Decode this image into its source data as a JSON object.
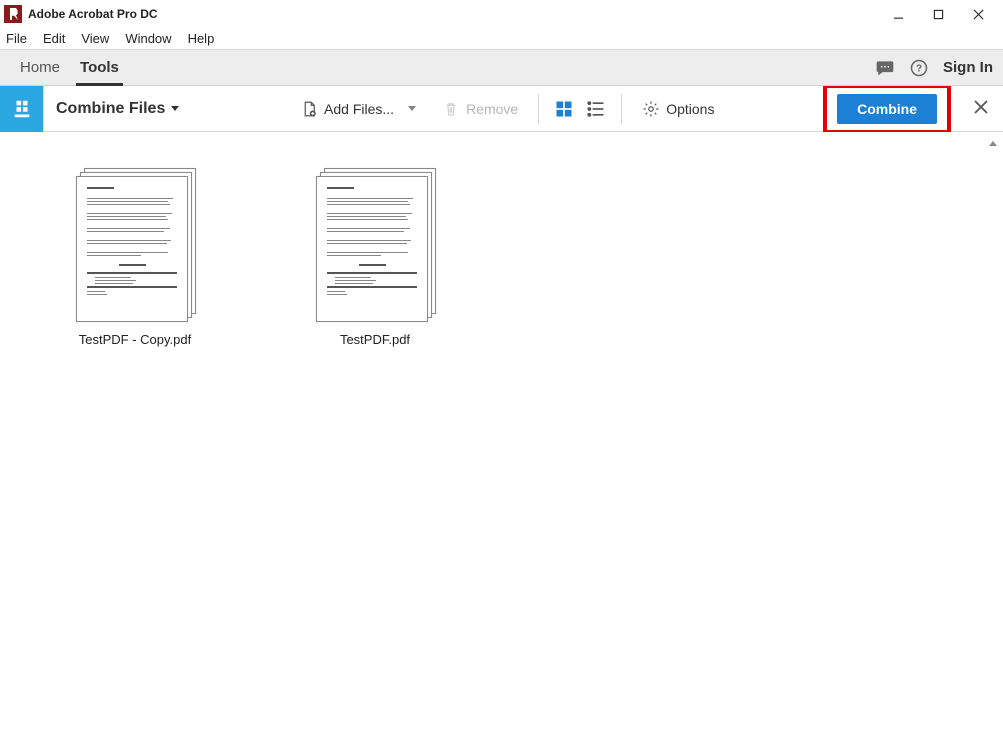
{
  "window": {
    "title": "Adobe Acrobat Pro DC"
  },
  "menubar": [
    "File",
    "Edit",
    "View",
    "Window",
    "Help"
  ],
  "tabbar": {
    "tabs": [
      "Home",
      "Tools"
    ],
    "active_index": 1,
    "signin": "Sign In"
  },
  "toolbar": {
    "title": "Combine Files",
    "add_files": "Add Files...",
    "remove": "Remove",
    "options": "Options",
    "combine": "Combine"
  },
  "files": [
    {
      "name": "TestPDF - Copy.pdf"
    },
    {
      "name": "TestPDF.pdf"
    }
  ]
}
